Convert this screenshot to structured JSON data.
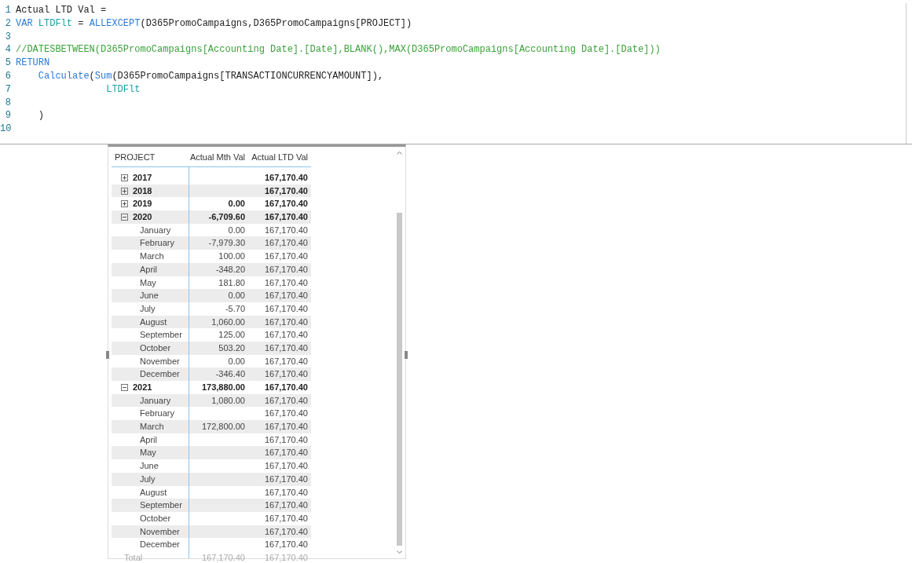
{
  "editor": {
    "lines": [
      {
        "number": "1",
        "tokens": [
          {
            "kind": "plain",
            "text": "Actual LTD Val ="
          }
        ]
      },
      {
        "number": "2",
        "tokens": [
          {
            "kind": "keyword",
            "text": "VAR "
          },
          {
            "kind": "variable",
            "text": "LTDFlt"
          },
          {
            "kind": "plain",
            "text": " = "
          },
          {
            "kind": "function",
            "text": "ALLEXCEPT"
          },
          {
            "kind": "plain",
            "text": "(D365PromoCampaigns,D365PromoCampaigns[PROJECT])"
          }
        ]
      },
      {
        "number": "3"
      },
      {
        "number": "4",
        "tokens": [
          {
            "kind": "comment",
            "text": "//DATESBETWEEN(D365PromoCampaigns[Accounting Date].[Date],BLANK(),MAX(D365PromoCampaigns[Accounting Date].[Date]))"
          }
        ]
      },
      {
        "number": "5",
        "tokens": [
          {
            "kind": "keyword",
            "text": "RETURN"
          }
        ]
      },
      {
        "number": "6",
        "kind": "body",
        "tokens": [
          {
            "kind": "function",
            "text": "Calculate"
          },
          {
            "kind": "plain",
            "text": "("
          },
          {
            "kind": "function",
            "text": "Sum"
          },
          {
            "kind": "plain",
            "text": "(D365PromoCampaigns[TRANSACTIONCURRENCYAMOUNT]),"
          }
        ]
      },
      {
        "number": "7",
        "kind": "nested",
        "tokens": [
          {
            "kind": "variable",
            "text": "LTDFlt"
          }
        ]
      },
      {
        "number": "8"
      },
      {
        "number": "9",
        "kind": "body",
        "tokens": [
          {
            "kind": "plain",
            "text": ")"
          }
        ]
      },
      {
        "number": "10"
      }
    ]
  },
  "matrix": {
    "columns": [
      "PROJECT",
      "Actual Mth Val",
      "Actual LTD Val"
    ],
    "rows": [
      {
        "kind": "year",
        "label": "2017",
        "expanded": false,
        "ltd": "167,170.40"
      },
      {
        "kind": "year",
        "label": "2018",
        "expanded": false,
        "ltd": "167,170.40"
      },
      {
        "kind": "year",
        "label": "2019",
        "expanded": false,
        "mth": "0.00",
        "ltd": "167,170.40"
      },
      {
        "kind": "year",
        "label": "2020",
        "expanded": true,
        "mth": "-6,709.60",
        "ltd": "167,170.40"
      },
      {
        "kind": "month",
        "label": "January",
        "mth": "0.00",
        "ltd": "167,170.40"
      },
      {
        "kind": "month",
        "label": "February",
        "mth": "-7,979.30",
        "ltd": "167,170.40"
      },
      {
        "kind": "month",
        "label": "March",
        "mth": "100.00",
        "ltd": "167,170.40"
      },
      {
        "kind": "month",
        "label": "April",
        "mth": "-348.20",
        "ltd": "167,170.40"
      },
      {
        "kind": "month",
        "label": "May",
        "mth": "181.80",
        "ltd": "167,170.40"
      },
      {
        "kind": "month",
        "label": "June",
        "mth": "0.00",
        "ltd": "167,170.40"
      },
      {
        "kind": "month",
        "label": "July",
        "mth": "-5.70",
        "ltd": "167,170.40"
      },
      {
        "kind": "month",
        "label": "August",
        "mth": "1,060.00",
        "ltd": "167,170.40"
      },
      {
        "kind": "month",
        "label": "September",
        "mth": "125.00",
        "ltd": "167,170.40"
      },
      {
        "kind": "month",
        "label": "October",
        "mth": "503.20",
        "ltd": "167,170.40"
      },
      {
        "kind": "month",
        "label": "November",
        "mth": "0.00",
        "ltd": "167,170.40"
      },
      {
        "kind": "month",
        "label": "December",
        "mth": "-346.40",
        "ltd": "167,170.40"
      },
      {
        "kind": "year",
        "label": "2021",
        "expanded": true,
        "mth": "173,880.00",
        "ltd": "167,170.40"
      },
      {
        "kind": "month",
        "label": "January",
        "mth": "1,080.00",
        "ltd": "167,170.40"
      },
      {
        "kind": "month",
        "label": "February",
        "ltd": "167,170.40"
      },
      {
        "kind": "month",
        "label": "March",
        "mth": "172,800.00",
        "ltd": "167,170.40"
      },
      {
        "kind": "month",
        "label": "April",
        "ltd": "167,170.40"
      },
      {
        "kind": "month",
        "label": "May",
        "ltd": "167,170.40"
      },
      {
        "kind": "month",
        "label": "June",
        "ltd": "167,170.40"
      },
      {
        "kind": "month",
        "label": "July",
        "ltd": "167,170.40"
      },
      {
        "kind": "month",
        "label": "August",
        "ltd": "167,170.40"
      },
      {
        "kind": "month",
        "label": "September",
        "ltd": "167,170.40"
      },
      {
        "kind": "month",
        "label": "October",
        "ltd": "167,170.40"
      },
      {
        "kind": "month",
        "label": "November",
        "ltd": "167,170.40"
      },
      {
        "kind": "month",
        "label": "December",
        "ltd": "167,170.40"
      }
    ],
    "total": {
      "label": "Total",
      "mth": "167,170.40",
      "ltd": "167,170.40"
    }
  }
}
